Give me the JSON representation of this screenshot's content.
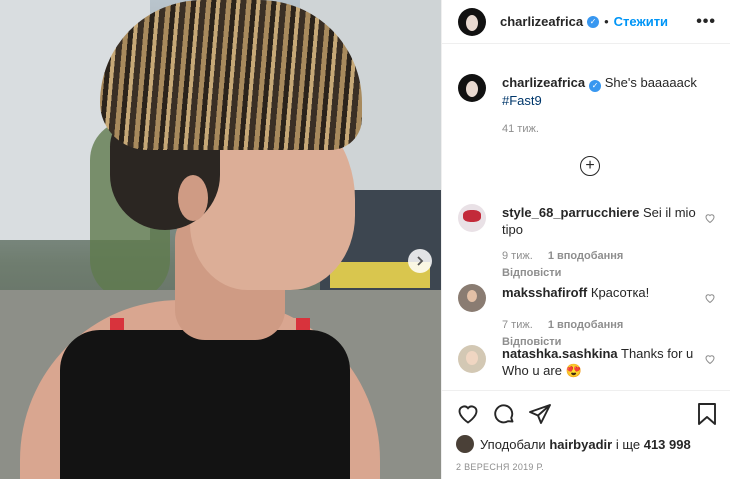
{
  "post": {
    "image": {
      "description_icon": "photo"
    },
    "carousel_next": "›"
  },
  "header": {
    "username": "charlizeafrica",
    "separator": "•",
    "follow_label": "Стежити",
    "more_label": "•••"
  },
  "caption": {
    "username": "charlizeafrica",
    "text": "She's baaaaack",
    "hashtag": "#Fast9",
    "time": "41 тиж."
  },
  "load_more": "+",
  "comments": [
    {
      "username": "style_68_parrucchiere",
      "text": "Sei il mio tipo",
      "time": "9 тиж.",
      "likes": "1 вподобання",
      "reply": "Відповісти"
    },
    {
      "username": "maksshafiroff",
      "text": "Красотка!",
      "time": "7 тиж.",
      "likes": "1 вподобання",
      "reply": "Відповісти"
    },
    {
      "username": "natashka.sashkina",
      "text": "Thanks for u Who u are 😍",
      "time": "",
      "likes": "",
      "reply": ""
    }
  ],
  "likes": {
    "prefix": "Уподобали",
    "user": "hairbyadir",
    "middle": "і ще",
    "count": "413 998"
  },
  "date": "2 ВЕРЕСНЯ 2019 Р.",
  "colors": {
    "accent": "#0095f6",
    "verified": "#3897f0",
    "muted": "#8e8e8e"
  }
}
